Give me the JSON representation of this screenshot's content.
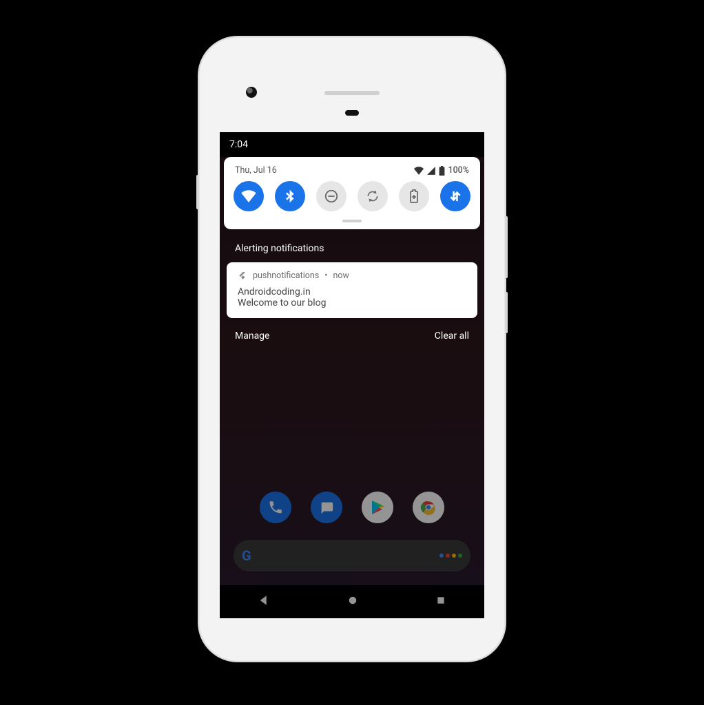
{
  "statusbar": {
    "time": "7:04"
  },
  "quick_settings": {
    "date": "Thu, Jul 16",
    "battery_text": "100%",
    "toggles": [
      {
        "name": "wifi",
        "on": true
      },
      {
        "name": "bluetooth",
        "on": true
      },
      {
        "name": "dnd",
        "on": false
      },
      {
        "name": "auto_rotate",
        "on": false
      },
      {
        "name": "battery_saver",
        "on": false
      },
      {
        "name": "mobile_data",
        "on": true
      }
    ]
  },
  "shade": {
    "section_label": "Alerting notifications",
    "manage_label": "Manage",
    "clear_label": "Clear all"
  },
  "notification": {
    "app_name": "pushnotifications",
    "when": "now",
    "title": "Androidcoding.in",
    "body": "Welcome to our blog"
  }
}
